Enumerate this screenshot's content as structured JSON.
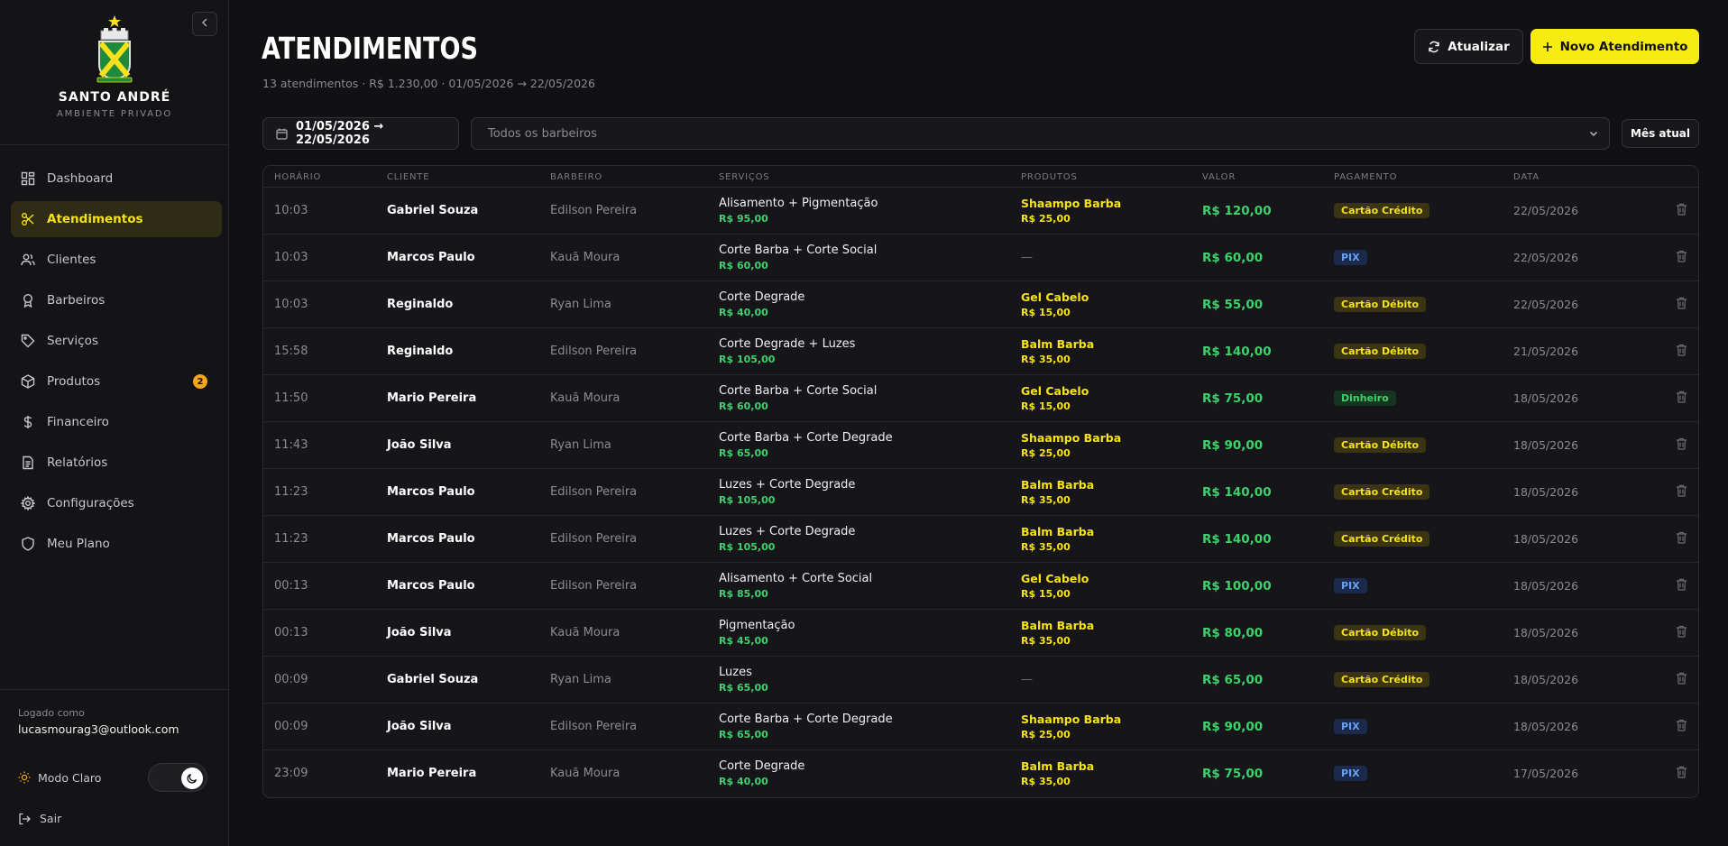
{
  "sidebar": {
    "brand_name": "SANTO ANDRÉ",
    "brand_sub": "AMBIENTE PRIVADO",
    "items": [
      {
        "label": "Dashboard",
        "icon": "dashboard-icon"
      },
      {
        "label": "Atendimentos",
        "icon": "scissors-icon",
        "active": true
      },
      {
        "label": "Clientes",
        "icon": "users-icon"
      },
      {
        "label": "Barbeiros",
        "icon": "award-icon"
      },
      {
        "label": "Serviços",
        "icon": "tag-icon"
      },
      {
        "label": "Produtos",
        "icon": "package-icon",
        "badge": "2"
      },
      {
        "label": "Financeiro",
        "icon": "dollar-icon"
      },
      {
        "label": "Relatórios",
        "icon": "file-text-icon"
      },
      {
        "label": "Configurações",
        "icon": "gear-icon"
      },
      {
        "label": "Meu Plano",
        "icon": "shield-icon"
      }
    ],
    "logged_label": "Logado como",
    "logged_email": "lucasmourag3@outlook.com",
    "mode_label": "Modo Claro",
    "logout_label": "Sair"
  },
  "header": {
    "title": "ATENDIMENTOS",
    "subtitle": "13 atendimentos · R$ 1.230,00 · 01/05/2026 → 22/05/2026",
    "refresh_label": "Atualizar",
    "new_label": "Novo Atendimento"
  },
  "filters": {
    "date_range": "01/05/2026 → 22/05/2026",
    "barber_placeholder": "Todos os barbeiros",
    "month_label": "Mês atual"
  },
  "table": {
    "columns": [
      "HORÁRIO",
      "CLIENTE",
      "BARBEIRO",
      "SERVIÇOS",
      "PRODUTOS",
      "VALOR",
      "PAGAMENTO",
      "DATA"
    ],
    "rows": [
      {
        "time": "10:03",
        "client": "Gabriel Souza",
        "barber": "Edilson Pereira",
        "service": "Alisamento + Pigmentação",
        "service_price": "R$ 95,00",
        "product": "Shaampo Barba",
        "product_price": "R$ 25,00",
        "value": "R$ 120,00",
        "payment": "Cartão Crédito",
        "pay_color": "yellow",
        "date": "22/05/2026"
      },
      {
        "time": "10:03",
        "client": "Marcos Paulo",
        "barber": "Kauã Moura",
        "service": "Corte Barba + Corte Social",
        "service_price": "R$ 60,00",
        "product": "",
        "product_price": "",
        "product_none": "—",
        "value": "R$ 60,00",
        "payment": "PIX",
        "pay_color": "blue",
        "date": "22/05/2026"
      },
      {
        "time": "10:03",
        "client": "Reginaldo",
        "barber": "Ryan Lima",
        "service": "Corte Degrade",
        "service_price": "R$ 40,00",
        "product": "Gel Cabelo",
        "product_price": "R$ 15,00",
        "value": "R$ 55,00",
        "payment": "Cartão Débito",
        "pay_color": "yellow",
        "date": "22/05/2026"
      },
      {
        "time": "15:58",
        "client": "Reginaldo",
        "barber": "Edilson Pereira",
        "service": "Corte Degrade + Luzes",
        "service_price": "R$ 105,00",
        "product": "Balm Barba",
        "product_price": "R$ 35,00",
        "value": "R$ 140,00",
        "payment": "Cartão Débito",
        "pay_color": "yellow",
        "date": "21/05/2026"
      },
      {
        "time": "11:50",
        "client": "Mario Pereira",
        "barber": "Kauã Moura",
        "service": "Corte Barba + Corte Social",
        "service_price": "R$ 60,00",
        "product": "Gel Cabelo",
        "product_price": "R$ 15,00",
        "value": "R$ 75,00",
        "payment": "Dinheiro",
        "pay_color": "green",
        "date": "18/05/2026"
      },
      {
        "time": "11:43",
        "client": "João Silva",
        "barber": "Ryan Lima",
        "service": "Corte Barba + Corte Degrade",
        "service_price": "R$ 65,00",
        "product": "Shaampo Barba",
        "product_price": "R$ 25,00",
        "value": "R$ 90,00",
        "payment": "Cartão Débito",
        "pay_color": "yellow",
        "date": "18/05/2026"
      },
      {
        "time": "11:23",
        "client": "Marcos Paulo",
        "barber": "Edilson Pereira",
        "service": "Luzes + Corte Degrade",
        "service_price": "R$ 105,00",
        "product": "Balm Barba",
        "product_price": "R$ 35,00",
        "value": "R$ 140,00",
        "payment": "Cartão Crédito",
        "pay_color": "yellow",
        "date": "18/05/2026"
      },
      {
        "time": "11:23",
        "client": "Marcos Paulo",
        "barber": "Edilson Pereira",
        "service": "Luzes + Corte Degrade",
        "service_price": "R$ 105,00",
        "product": "Balm Barba",
        "product_price": "R$ 35,00",
        "value": "R$ 140,00",
        "payment": "Cartão Crédito",
        "pay_color": "yellow",
        "date": "18/05/2026"
      },
      {
        "time": "00:13",
        "client": "Marcos Paulo",
        "barber": "Edilson Pereira",
        "service": "Alisamento + Corte Social",
        "service_price": "R$ 85,00",
        "product": "Gel Cabelo",
        "product_price": "R$ 15,00",
        "value": "R$ 100,00",
        "payment": "PIX",
        "pay_color": "blue",
        "date": "18/05/2026"
      },
      {
        "time": "00:13",
        "client": "João Silva",
        "barber": "Kauã Moura",
        "service": "Pigmentação",
        "service_price": "R$ 45,00",
        "product": "Balm Barba",
        "product_price": "R$ 35,00",
        "value": "R$ 80,00",
        "payment": "Cartão Débito",
        "pay_color": "yellow",
        "date": "18/05/2026"
      },
      {
        "time": "00:09",
        "client": "Gabriel Souza",
        "barber": "Ryan Lima",
        "service": "Luzes",
        "service_price": "R$ 65,00",
        "product": "",
        "product_price": "",
        "product_none": "—",
        "value": "R$ 65,00",
        "payment": "Cartão Crédito",
        "pay_color": "yellow",
        "date": "18/05/2026"
      },
      {
        "time": "00:09",
        "client": "João Silva",
        "barber": "Edilson Pereira",
        "service": "Corte Barba + Corte Degrade",
        "service_price": "R$ 65,00",
        "product": "Shaampo Barba",
        "product_price": "R$ 25,00",
        "value": "R$ 90,00",
        "payment": "PIX",
        "pay_color": "blue",
        "date": "18/05/2026"
      },
      {
        "time": "23:09",
        "client": "Mario Pereira",
        "barber": "Kauã Moura",
        "service": "Corte Degrade",
        "service_price": "R$ 40,00",
        "product": "Balm Barba",
        "product_price": "R$ 35,00",
        "value": "R$ 75,00",
        "payment": "PIX",
        "pay_color": "blue",
        "date": "17/05/2026"
      }
    ]
  },
  "colors": {
    "accent": "#f7ec12",
    "money_green": "#3ed16b",
    "background": "#111114"
  }
}
